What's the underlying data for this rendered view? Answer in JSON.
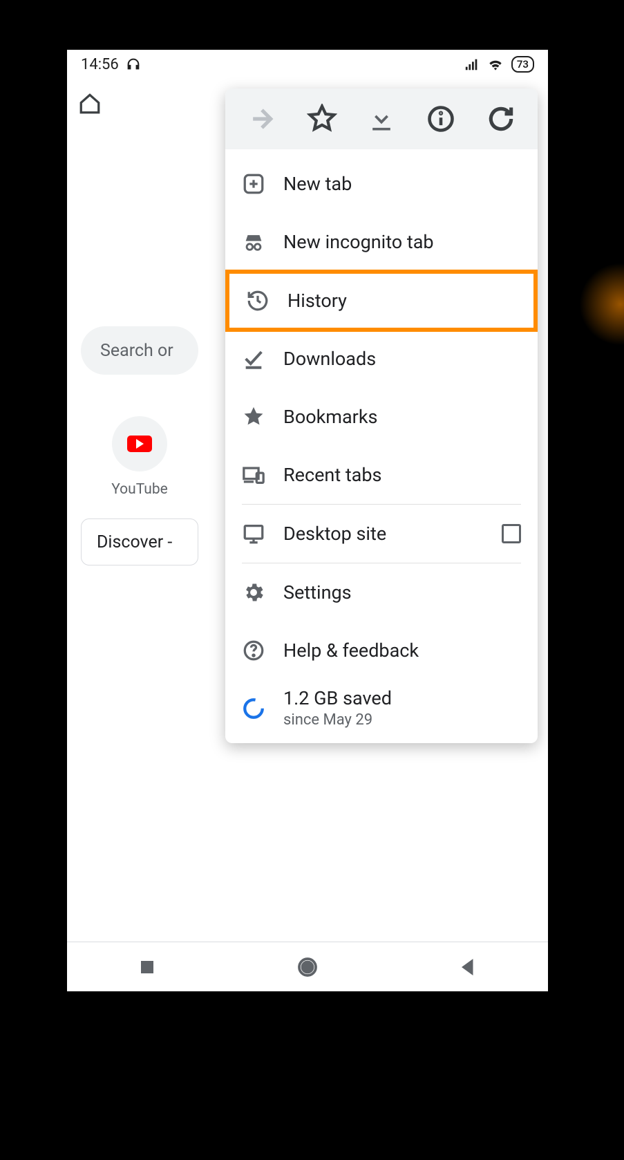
{
  "status": {
    "time": "14:56",
    "battery": "73"
  },
  "search_placeholder": "Search or",
  "shortcut": {
    "label": "YouTube"
  },
  "discover_label": "Discover -",
  "menu": {
    "new_tab": "New tab",
    "incognito": "New incognito tab",
    "history": "History",
    "downloads": "Downloads",
    "bookmarks": "Bookmarks",
    "recent_tabs": "Recent tabs",
    "desktop_site": "Desktop site",
    "settings": "Settings",
    "help": "Help & feedback",
    "data_saved": "1.2 GB saved",
    "data_since": "since May 29"
  }
}
